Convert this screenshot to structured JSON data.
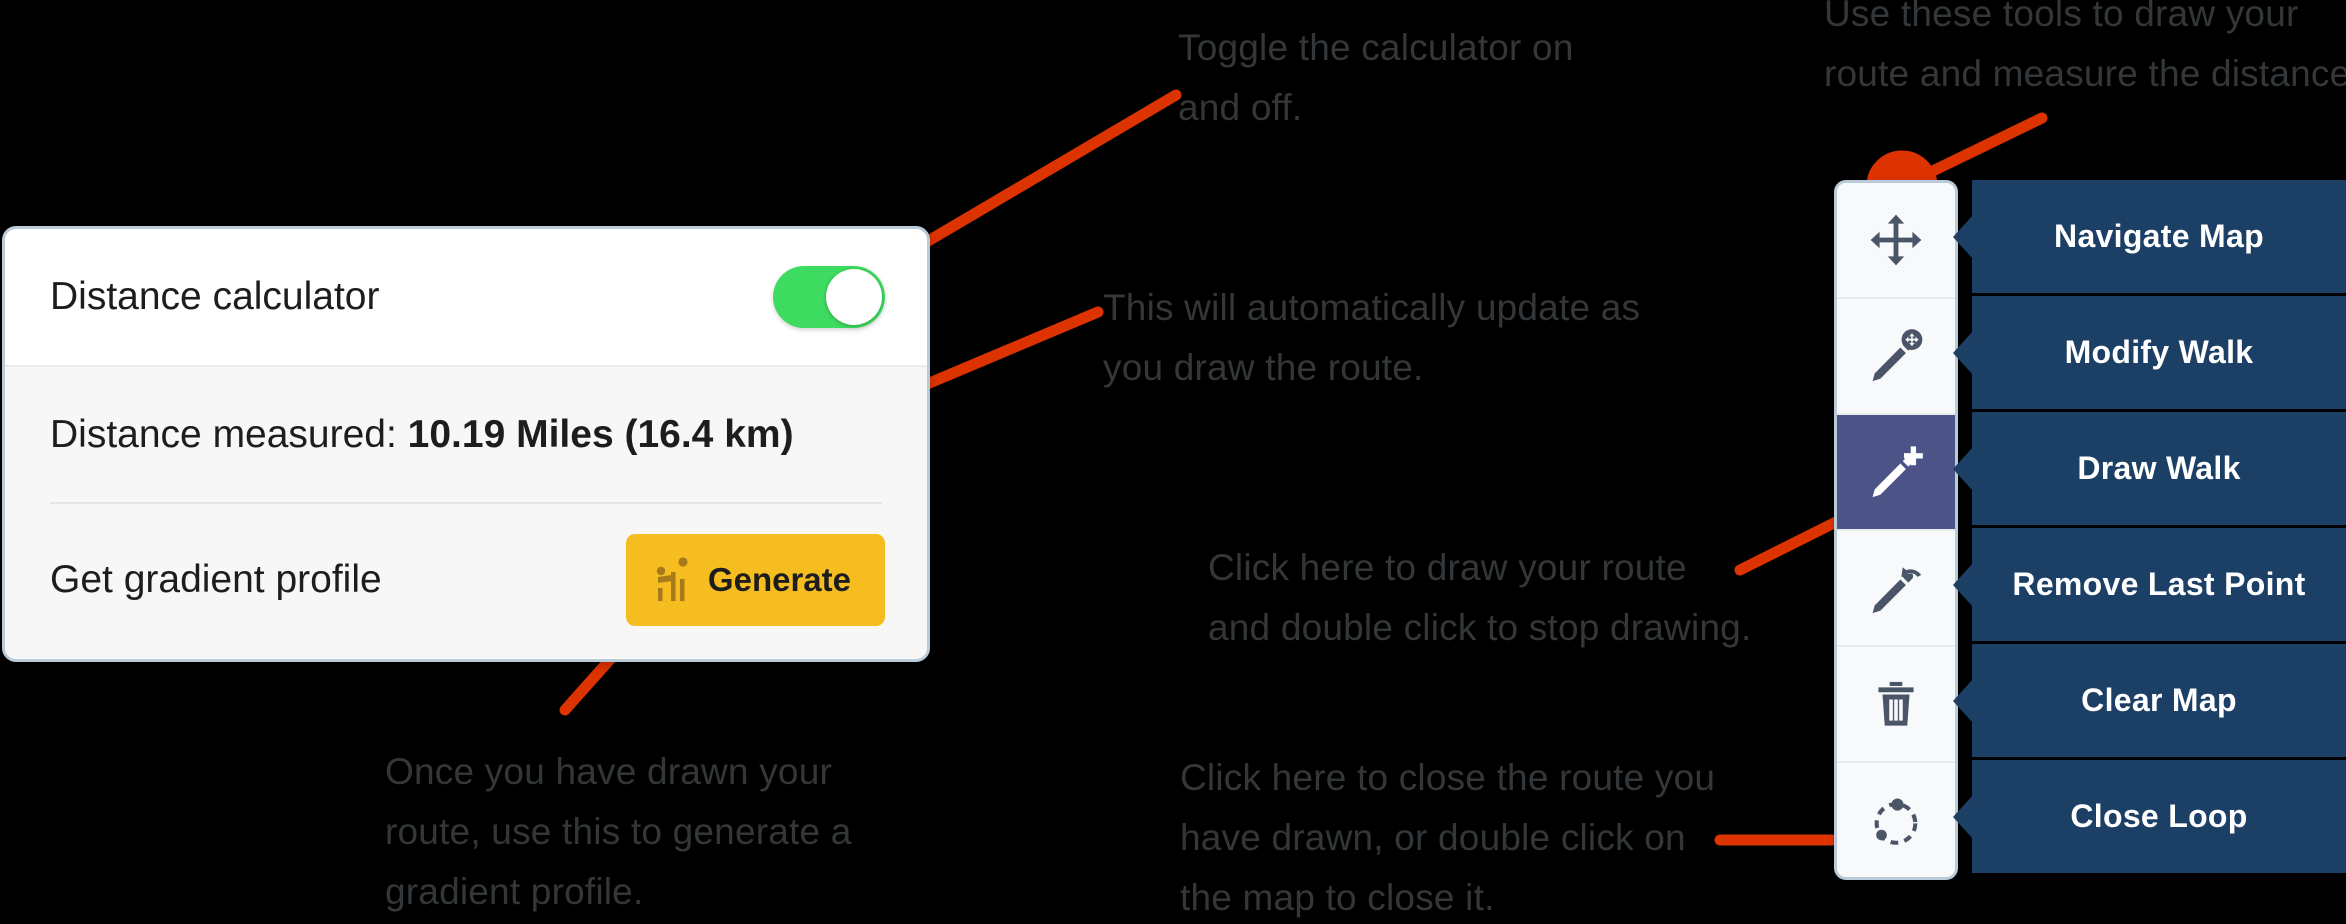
{
  "annotations": [
    {
      "id": "toggle-note",
      "text": "Toggle the calculator on\nand off."
    },
    {
      "id": "tools-note",
      "text": "Use these tools to draw your\nroute and measure the distance."
    },
    {
      "id": "distance-note",
      "text": "This will automatically update as\nyou draw the route."
    },
    {
      "id": "draw-note",
      "text": "Click here to draw your route\nand double click to stop drawing."
    },
    {
      "id": "generate-note",
      "text": "Once you have drawn your\nroute, use this to generate a\ngradient profile."
    },
    {
      "id": "close-loop-note",
      "text": "Click here to close the route you\nhave drawn, or double click on\nthe map to close it."
    }
  ],
  "calculator_card": {
    "toggle_row": {
      "label": "Distance calculator",
      "toggle_state": "on",
      "toggle_icon": "toggle-switch-on-icon"
    },
    "distance_row": {
      "prefix": "Distance measured: ",
      "value": "10.19 Miles (16.4 km)"
    },
    "gradient_row": {
      "label": "Get gradient profile",
      "button_label": "Generate",
      "button_icon": "chart-profile-icon"
    }
  },
  "tool_panel": {
    "tools": [
      {
        "name": "navigate-map",
        "icon": "arrows-move-icon",
        "tooltip": "Navigate Map",
        "active": false
      },
      {
        "name": "modify-walk",
        "icon": "pencil-move-icon",
        "tooltip": "Modify Walk",
        "active": false
      },
      {
        "name": "draw-walk",
        "icon": "pencil-plus-icon",
        "tooltip": "Draw Walk",
        "active": true
      },
      {
        "name": "remove-last-point",
        "icon": "pencil-undo-icon",
        "tooltip": "Remove Last Point",
        "active": false
      },
      {
        "name": "clear-map",
        "icon": "trash-icon",
        "tooltip": "Clear Map",
        "active": false
      },
      {
        "name": "close-loop",
        "icon": "close-loop-circle-icon",
        "tooltip": "Close Loop",
        "active": false
      }
    ]
  },
  "colors": {
    "annotation_red": "#dd3300",
    "toggle_green": "#3ddc61",
    "generate_amber": "#f6bd20",
    "tooltip_navy": "#1c3f66",
    "active_tool": "#4c5386",
    "card_border": "#b9cbd8",
    "background": "#000000"
  }
}
